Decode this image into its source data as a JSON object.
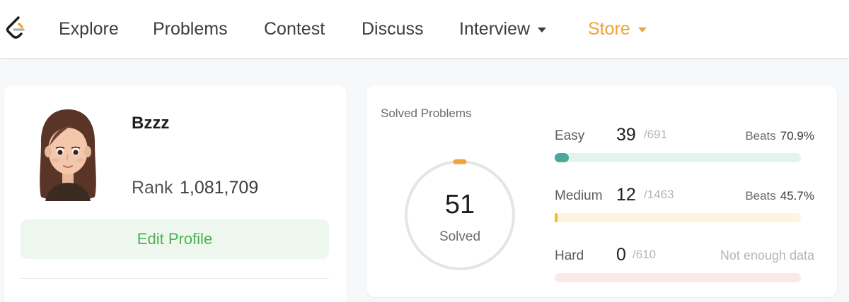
{
  "nav": {
    "items": [
      {
        "label": "Explore"
      },
      {
        "label": "Problems"
      },
      {
        "label": "Contest"
      },
      {
        "label": "Discuss"
      },
      {
        "label": "Interview"
      },
      {
        "label": "Store"
      }
    ],
    "accent": "#f0a336"
  },
  "profile": {
    "username": "Bzzz",
    "rank_label": "Rank",
    "rank_value": "1,081,709",
    "edit_label": "Edit Profile"
  },
  "stats": {
    "title": "Solved Problems",
    "solved_count": "51",
    "solved_label": "Solved",
    "easy": {
      "label": "Easy",
      "count": "39",
      "total": "/691",
      "beats_label": "Beats",
      "beats_value": "70.9%",
      "progress": 0.056,
      "color": "#4ba89a",
      "track": "#e4f4ec"
    },
    "medium": {
      "label": "Medium",
      "count": "12",
      "total": "/1463",
      "beats_label": "Beats",
      "beats_value": "45.7%",
      "progress": 0.008,
      "color": "#f5b82e",
      "track": "#fcf5e2"
    },
    "hard": {
      "label": "Hard",
      "count": "0",
      "total": "/610",
      "no_data": "Not enough data",
      "progress": 0,
      "color": "#ef4743",
      "track": "#fbe9e8"
    }
  }
}
